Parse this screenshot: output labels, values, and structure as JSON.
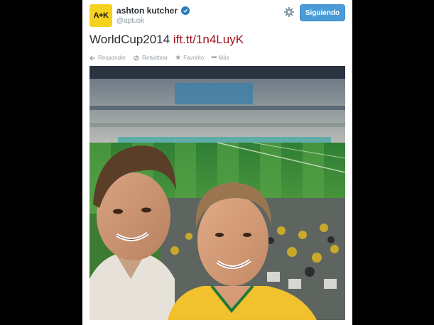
{
  "tweet": {
    "author_name": "ashton kutcher",
    "author_handle": "@aplusk",
    "avatar_text": "A+K",
    "follow_label": "Siguiendo",
    "text": "WorldCup2014",
    "link_text": "ift.tt/1n4LuyK",
    "actions": {
      "reply": "Responder",
      "retweet": "Retwittear",
      "favorite": "Favorito",
      "more": "Más"
    },
    "icons": [
      "verified-badge-icon",
      "gear-icon",
      "reply-icon",
      "retweet-icon",
      "star-icon",
      "more-icon"
    ],
    "colors": {
      "follow_button": "#4a9bd8",
      "link": "#a0141e",
      "avatar_bg": "#f4d21f",
      "verified": "#2b7bb9"
    }
  }
}
